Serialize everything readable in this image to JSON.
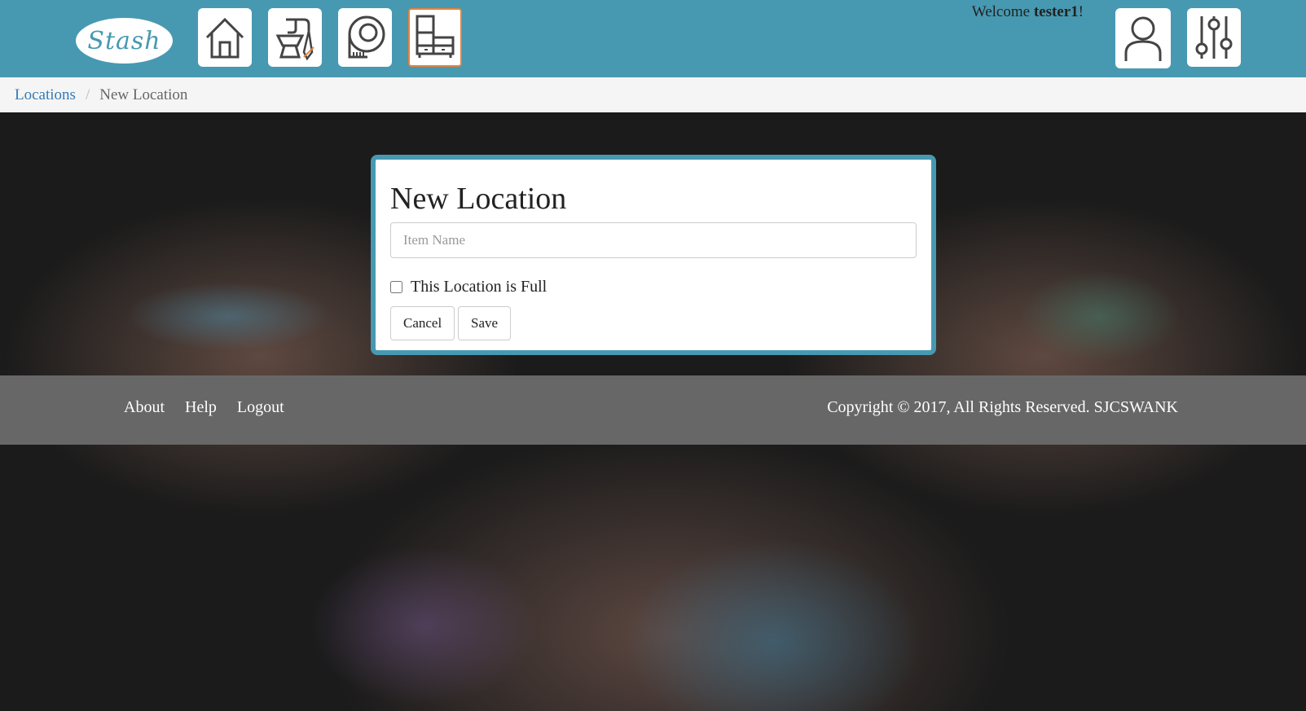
{
  "header": {
    "logo_text": "Stash",
    "nav": [
      {
        "name": "home",
        "icon": "house-icon"
      },
      {
        "name": "sewing",
        "icon": "sewing-machine-icon"
      },
      {
        "name": "patterns",
        "icon": "pattern-tape-icon"
      },
      {
        "name": "locations",
        "icon": "dresser-icon",
        "active": true
      }
    ],
    "welcome_prefix": "Welcome ",
    "username": "tester1",
    "welcome_suffix": "!",
    "profile_icon": "user-icon",
    "settings_icon": "sliders-icon",
    "accent_color": "#4799b1",
    "active_border_color": "#e8833a"
  },
  "breadcrumb": {
    "items": [
      {
        "label": "Locations"
      },
      {
        "label": "New Location"
      }
    ],
    "separator": "/"
  },
  "form": {
    "title": "New Location",
    "name_placeholder": "Item Name",
    "name_value": "",
    "full_checkbox_label": "This Location is Full",
    "full_checked": false,
    "cancel_label": "Cancel",
    "save_label": "Save"
  },
  "footer": {
    "links": [
      "About",
      "Help",
      "Logout"
    ],
    "copyright": "Copyright © 2017, All Rights Reserved. SJCSWANK"
  }
}
